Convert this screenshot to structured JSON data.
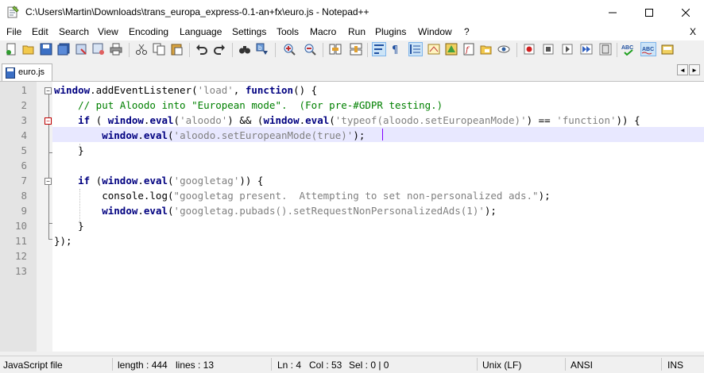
{
  "window": {
    "title": "C:\\Users\\Martin\\Downloads\\trans_europa_express-0.1-an+fx\\euro.js - Notepad++"
  },
  "menu": [
    "File",
    "Edit",
    "Search",
    "View",
    "Encoding",
    "Language",
    "Settings",
    "Tools",
    "Macro",
    "Run",
    "Plugins",
    "Window",
    "?"
  ],
  "menu_close": "X",
  "tab": {
    "label": "euro.js",
    "arrow_left": "◄",
    "arrow_right": "►"
  },
  "editor": {
    "line_numbers": [
      "1",
      "2",
      "3",
      "4",
      "5",
      "6",
      "7",
      "8",
      "9",
      "10",
      "11",
      "12",
      "13"
    ],
    "lines": [
      [
        {
          "t": "window",
          "c": "k"
        },
        {
          "t": ".addEventListener("
        },
        {
          "t": "'load'",
          "c": "s"
        },
        {
          "t": ", "
        },
        {
          "t": "function",
          "c": "k"
        },
        {
          "t": "() {"
        }
      ],
      [
        {
          "t": "    "
        },
        {
          "t": "// put Aloodo into \"European mode\".  (For pre-#GDPR testing.)",
          "c": "c"
        }
      ],
      [
        {
          "t": "    "
        },
        {
          "t": "if",
          "c": "k"
        },
        {
          "t": " ( "
        },
        {
          "t": "window",
          "c": "k"
        },
        {
          "t": "."
        },
        {
          "t": "eval",
          "c": "k"
        },
        {
          "t": "("
        },
        {
          "t": "'aloodo'",
          "c": "s"
        },
        {
          "t": ") && ("
        },
        {
          "t": "window",
          "c": "k"
        },
        {
          "t": "."
        },
        {
          "t": "eval",
          "c": "k"
        },
        {
          "t": "("
        },
        {
          "t": "'typeof(aloodo.setEuropeanMode)'",
          "c": "s"
        },
        {
          "t": ") == "
        },
        {
          "t": "'function'",
          "c": "s"
        },
        {
          "t": ")) {"
        }
      ],
      [
        {
          "t": "        "
        },
        {
          "t": "window",
          "c": "k"
        },
        {
          "t": "."
        },
        {
          "t": "eval",
          "c": "k"
        },
        {
          "t": "("
        },
        {
          "t": "'aloodo.setEuropeanMode(true)'",
          "c": "s"
        },
        {
          "t": ");"
        }
      ],
      [
        {
          "t": "    }"
        }
      ],
      [
        {
          "t": ""
        }
      ],
      [
        {
          "t": "    "
        },
        {
          "t": "if",
          "c": "k"
        },
        {
          "t": " ("
        },
        {
          "t": "window",
          "c": "k"
        },
        {
          "t": "."
        },
        {
          "t": "eval",
          "c": "k"
        },
        {
          "t": "("
        },
        {
          "t": "'googletag'",
          "c": "s"
        },
        {
          "t": ")) {"
        }
      ],
      [
        {
          "t": "        console.log("
        },
        {
          "t": "\"googletag present.  Attempting to set non-personalized ads.\"",
          "c": "s"
        },
        {
          "t": ");"
        }
      ],
      [
        {
          "t": "        "
        },
        {
          "t": "window",
          "c": "k"
        },
        {
          "t": "."
        },
        {
          "t": "eval",
          "c": "k"
        },
        {
          "t": "("
        },
        {
          "t": "'googletag.pubads().setRequestNonPersonalizedAds(1)'",
          "c": "s"
        },
        {
          "t": ");"
        }
      ],
      [
        {
          "t": "    }"
        }
      ],
      [
        {
          "t": "});"
        }
      ],
      [
        {
          "t": ""
        }
      ],
      [
        {
          "t": ""
        }
      ]
    ]
  },
  "status": {
    "language": "JavaScript file",
    "length": "length : 444",
    "lines": "lines : 13",
    "ln": "Ln : 4",
    "col": "Col : 53",
    "sel": "Sel : 0 | 0",
    "eol": "Unix (LF)",
    "encoding": "ANSI",
    "mode": "INS"
  },
  "colors": {
    "keyword": "#000080",
    "string": "#808080",
    "comment": "#008000",
    "current_line": "#e8e8ff",
    "caret": "#8000ff"
  }
}
